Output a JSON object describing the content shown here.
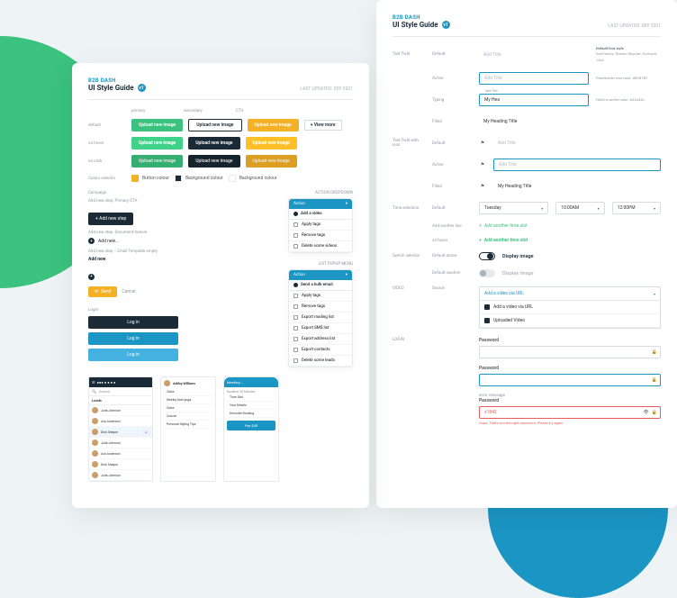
{
  "brand": "B2B DASH",
  "title": "UI Style Guide",
  "version": "v1",
  "updated": "LAST UPDATED: SEP 2021",
  "left": {
    "cols": [
      "primary",
      "secondary",
      "CTA"
    ],
    "rows": [
      "default",
      "on hover",
      "on click"
    ],
    "btn_primary": "Upload new image",
    "btn_secondary": "Upload new image",
    "btn_cta": "Upload new image",
    "view_more": "+ View more",
    "colour_selector": "Colour selector",
    "swatches": [
      "Button colour",
      "Background colour",
      "Background colour"
    ],
    "campaign": "Campaign",
    "add_step_label": "Add new step. Primary CTA",
    "add_step_btn": "+ Add new step",
    "add_new_label": "Add new step. Document feature",
    "add_new_text": "Add new...",
    "add_email_label": "Add new step – Email Template empty",
    "add_new_btn": "Add new",
    "send_btn": "Send",
    "cancel": "Cancel",
    "action_dropdown": "ACTION DROPDOWN",
    "dd1_action": "Action",
    "dd1_title": "Add a video",
    "dd1_items": [
      "Apply tags",
      "Remove tags",
      "Delete some videos"
    ],
    "list_popup": "LIST POPUP MENU",
    "dd2_title": "Send a bulk email",
    "dd2_items": [
      "Apply tags",
      "Remove tags",
      "Export mailing list",
      "Export SMS list",
      "Export address list",
      "Export contacts",
      "Delete some leads"
    ],
    "login": "Login",
    "login_btn": "Log in",
    "contact_panel": {
      "search": "Search",
      "title": "Leads",
      "items": [
        "Julia Johnson",
        "Ava Anderson",
        "Dick Shayne",
        "Julia Johnson",
        "Ava Anderson",
        "Dick Shayne",
        "Julia Johnson"
      ]
    },
    "rich_panel": {
      "title": "Ashley Williams",
      "rows": [
        "Class",
        "Weekly 6am yoga",
        "Class",
        "Course",
        "Personal Styling Tips"
      ]
    },
    "sched_panel": {
      "title": "Meeting...",
      "duration": "Duration 45 Minutes",
      "rows": [
        "Time Slot",
        "Your Details",
        "Describe Booking"
      ],
      "pay": "Pay $45"
    }
  },
  "right": {
    "sec_textfield": "Text Field",
    "states": {
      "default": "Default",
      "active": "Active",
      "typing": "Typing",
      "filled": "Filled"
    },
    "placeholder": "Add Title",
    "typing_val": "My Hea",
    "filled_val": "My Heading Title",
    "notes": {
      "t1": "Default font style",
      "t2": "font-family: 'Roboto Regular'; font-size: 14px",
      "t3": "Placeholder text color: #B7B7B7",
      "t4": "Filled or active color: #444444"
    },
    "sec_icon": "Text Field with icon",
    "sec_time": "Time selection",
    "day": "Tuesday",
    "t_from": "10:00AM",
    "t_to": "12:00PM",
    "add_time": "Add another time slot",
    "on_hover": "on hover",
    "sec_switch": "Switch selector",
    "active_def": "Default active",
    "inactive_def": "Default inactive",
    "switch_label": "Display image",
    "sec_video": "VIDEO",
    "video_source": "Source",
    "video_hdr": "Add a video via URL",
    "video_o1": "Add a video via URL",
    "video_o2": "Uploaded Video",
    "sec_login": "LOGIN",
    "pw": "Password",
    "err_label": "error message",
    "pw_val": "z1842",
    "err_msg": "Oops. That's not the right password. Please try again."
  }
}
